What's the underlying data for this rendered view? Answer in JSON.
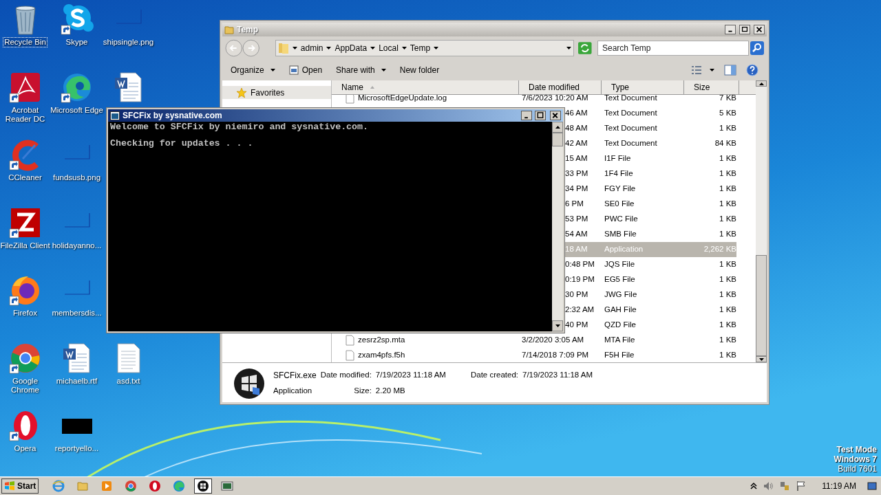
{
  "desktop_icons": [
    [
      {
        "label": "Recycle Bin",
        "kind": "recycle",
        "shortcut": false,
        "focused": true
      },
      {
        "label": "Skype",
        "kind": "skype",
        "shortcut": true,
        "focused": false
      },
      {
        "label": "shipsingle.png",
        "kind": "blank",
        "shortcut": false,
        "focused": false
      }
    ],
    [
      {
        "label": "Acrobat Reader DC",
        "kind": "acrobat",
        "shortcut": true,
        "focused": false
      },
      {
        "label": "Microsoft Edge",
        "kind": "edge",
        "shortcut": true,
        "focused": false
      },
      {
        "kind": "word",
        "shortcut": false
      }
    ],
    [
      {
        "label": "CCleaner",
        "kind": "ccleaner",
        "shortcut": true,
        "focused": false
      },
      {
        "label": "fundsusb.png",
        "kind": "blank",
        "shortcut": false,
        "focused": false
      }
    ],
    [
      {
        "label": "FileZilla Client",
        "kind": "filezilla",
        "shortcut": true,
        "focused": false
      },
      {
        "label": "holidayanno...",
        "kind": "blank",
        "shortcut": false,
        "focused": false
      }
    ],
    [
      {
        "label": "Firefox",
        "kind": "firefox",
        "shortcut": true,
        "focused": false
      },
      {
        "label": "membersdis...",
        "kind": "blank",
        "shortcut": false,
        "focused": false
      }
    ],
    [
      {
        "label": "Google Chrome",
        "kind": "chrome",
        "shortcut": true,
        "focused": false
      },
      {
        "label": "michaelb.rtf",
        "kind": "word",
        "shortcut": false,
        "focused": false
      },
      {
        "label": "asd.txt",
        "kind": "text",
        "shortcut": false,
        "focused": false
      }
    ],
    [
      {
        "label": "Opera",
        "kind": "opera",
        "shortcut": true,
        "focused": false
      },
      {
        "label": "reportyello...",
        "kind": "black",
        "shortcut": false,
        "focused": false
      }
    ]
  ],
  "explorer": {
    "title": "Temp",
    "breadcrumb": [
      "admin",
      "AppData",
      "Local",
      "Temp"
    ],
    "search": {
      "placeholder": "Search Temp"
    },
    "toolbar": [
      {
        "label": "Organize",
        "kind": "menu"
      },
      {
        "label": "Open",
        "kind": "open"
      },
      {
        "label": "Share with",
        "kind": "menu"
      },
      {
        "label": "New folder",
        "kind": "plain"
      }
    ],
    "nav": [
      {
        "label": "Favorites",
        "selected": true
      }
    ],
    "columns": [
      "Name",
      "Date modified",
      "Type",
      "Size"
    ],
    "rows": [
      {
        "name": "MicrosoftEdgeUpdate.log",
        "date": "7/6/2023 10:20 AM",
        "type": "Text Document",
        "size": "7 KB",
        "selected": false
      },
      {
        "date": "46 AM",
        "type": "Text Document",
        "size": "5 KB",
        "selected": false
      },
      {
        "date": "48 AM",
        "type": "Text Document",
        "size": "1 KB",
        "selected": false
      },
      {
        "date": "42 AM",
        "type": "Text Document",
        "size": "84 KB",
        "selected": false
      },
      {
        "date": "15 AM",
        "type": "I1F File",
        "size": "1 KB",
        "selected": false
      },
      {
        "date": "33 PM",
        "type": "1F4 File",
        "size": "1 KB",
        "selected": false
      },
      {
        "date": "34 PM",
        "type": "FGY File",
        "size": "1 KB",
        "selected": false
      },
      {
        "date": "6 PM",
        "type": "SE0 File",
        "size": "1 KB",
        "selected": false
      },
      {
        "date": "53 PM",
        "type": "PWC File",
        "size": "1 KB",
        "selected": false
      },
      {
        "date": "54 AM",
        "type": "SMB File",
        "size": "1 KB",
        "selected": false
      },
      {
        "date": "18 AM",
        "type": "Application",
        "size": "2,262 KB",
        "selected": true
      },
      {
        "date": "0:48 PM",
        "type": "JQS File",
        "size": "1 KB",
        "selected": false
      },
      {
        "date": "0:19 PM",
        "type": "EG5 File",
        "size": "1 KB",
        "selected": false
      },
      {
        "date": "30 PM",
        "type": "JWG File",
        "size": "1 KB",
        "selected": false
      },
      {
        "date": "2:32 AM",
        "type": "GAH File",
        "size": "1 KB",
        "selected": false
      },
      {
        "date": "40 PM",
        "type": "QZD File",
        "size": "1 KB",
        "selected": false
      },
      {
        "name": "zesrz2sp.mta",
        "date": "3/2/2020 3:05 AM",
        "type": "MTA File",
        "size": "1 KB",
        "selected": false
      },
      {
        "name": "zxam4pfs.f5h",
        "date": "7/14/2018 7:09 PM",
        "type": "F5H File",
        "size": "1 KB",
        "selected": false
      }
    ],
    "details": {
      "name": "SFCFix.exe",
      "type": "Application",
      "modified_label": "Date modified:",
      "modified": "7/19/2023 11:18 AM",
      "created_label": "Date created:",
      "created": "7/19/2023 11:18 AM",
      "size_label": "Size:",
      "size": "2.20 MB"
    }
  },
  "console": {
    "title": "SFCFix by sysnative.com",
    "lines": [
      "Welcome to SFCFix by niemiro and sysnative.com.",
      "Checking for updates . . ."
    ]
  },
  "taskbar": {
    "start": "Start",
    "apps": [
      {
        "kind": "ie",
        "active": false
      },
      {
        "kind": "folder",
        "active": false
      },
      {
        "kind": "media",
        "active": false
      },
      {
        "kind": "chrome",
        "active": false
      },
      {
        "kind": "opera",
        "active": false
      },
      {
        "kind": "edge",
        "active": false
      },
      {
        "kind": "sfcfix",
        "active": true
      },
      {
        "kind": "terminal",
        "active": false
      }
    ],
    "clock": "11:19 AM"
  },
  "watermark_text": [
    "Test Mode",
    "Windows 7",
    "Build 7601"
  ]
}
